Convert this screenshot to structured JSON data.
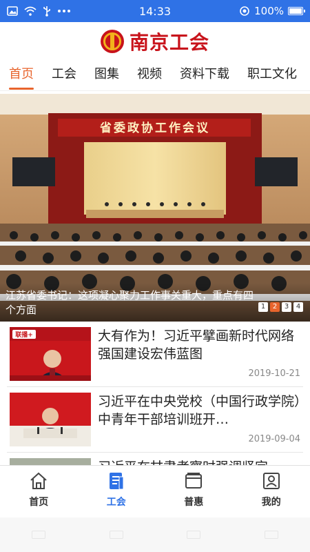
{
  "status_bar": {
    "time": "14:33",
    "battery": "100%",
    "battery_level": 1.0,
    "icons": [
      "image-icon",
      "wifi-icon",
      "usb-icon",
      "more-dots-icon",
      "location-icon",
      "battery-icon"
    ]
  },
  "header": {
    "logo_text": "南京工会",
    "logo_icon": "union-emblem-icon"
  },
  "tabs": [
    {
      "label": "首页",
      "active": true
    },
    {
      "label": "工会",
      "active": false
    },
    {
      "label": "图集",
      "active": false
    },
    {
      "label": "视频",
      "active": false
    },
    {
      "label": "资料下载",
      "active": false
    },
    {
      "label": "职工文化",
      "active": false
    }
  ],
  "banner": {
    "caption": "江苏省委书记：这项凝心聚力工作事关重大，重点有四个方面",
    "stage_sign": "省委政协工作会议",
    "pages": [
      "1",
      "2",
      "3",
      "4"
    ],
    "active_page": 2
  },
  "news": [
    {
      "title": "大有作为！习近平擘画新时代网络强国建设宏伟蓝图",
      "date": "2019-10-21",
      "thumb_text": "联播+"
    },
    {
      "title": "习近平在中央党校（中国行政学院）中青年干部培训班开…",
      "date": "2019-09-04",
      "thumb_text": ""
    },
    {
      "title": "习近平在甘肃考察时强调坚定",
      "date": "",
      "thumb_text": ""
    }
  ],
  "bottom_nav": [
    {
      "label": "首页",
      "icon": "home-icon",
      "active": false
    },
    {
      "label": "工会",
      "icon": "news-icon",
      "active": true
    },
    {
      "label": "普惠",
      "icon": "wallet-icon",
      "active": false
    },
    {
      "label": "我的",
      "icon": "profile-icon",
      "active": false
    }
  ],
  "colors": {
    "status_bar": "#2f72e6",
    "accent": "#e8642c",
    "brand_red": "#c8131b",
    "nav_active": "#2f72e6"
  }
}
